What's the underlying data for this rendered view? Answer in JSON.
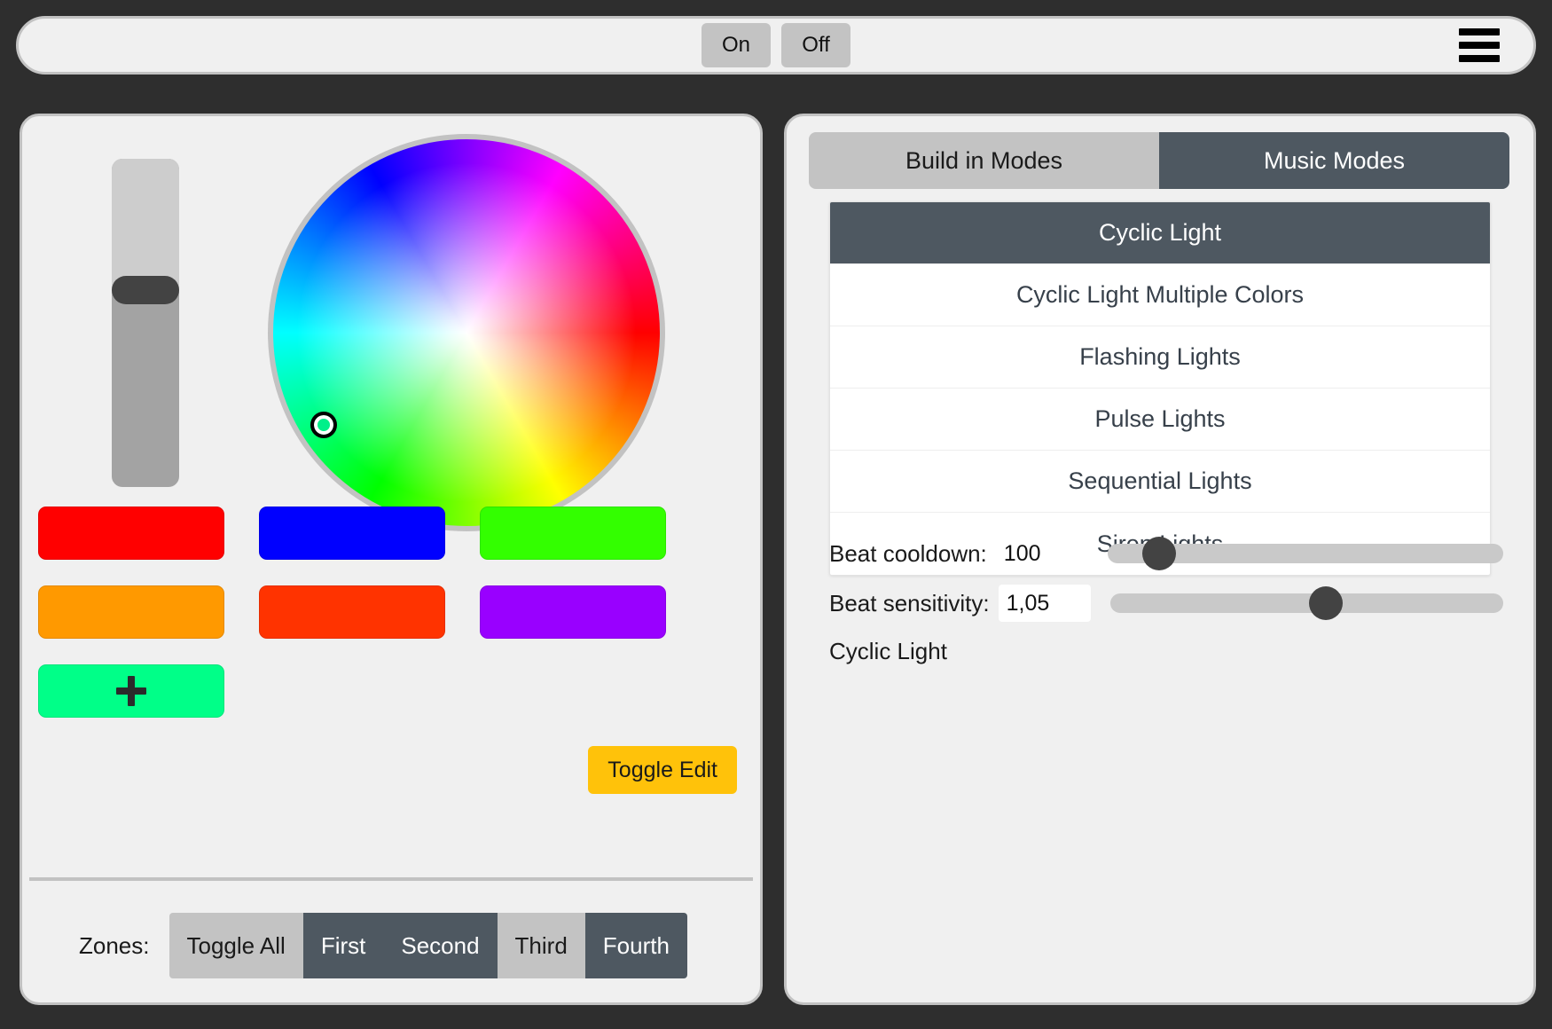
{
  "topbar": {
    "on_label": "On",
    "off_label": "Off",
    "menu_icon": "hamburger-menu-icon"
  },
  "left_panel": {
    "brightness_slider": {
      "name": "brightness-slider",
      "value_percent": 60
    },
    "color_wheel": {
      "name": "color-wheel",
      "selected_color": "#00f08a"
    },
    "swatches": [
      {
        "label": "",
        "color": "#FF0000",
        "name": "color-swatch-red"
      },
      {
        "label": "",
        "color": "#0000FF",
        "name": "color-swatch-blue"
      },
      {
        "label": "",
        "color": "#33FF00",
        "name": "color-swatch-green"
      },
      {
        "label": "",
        "color": "#FF9900",
        "name": "color-swatch-orange"
      },
      {
        "label": "",
        "color": "#FF3300",
        "name": "color-swatch-orangered"
      },
      {
        "label": "",
        "color": "#9900FF",
        "name": "color-swatch-purple"
      },
      {
        "label": "",
        "color": "#00FF88",
        "name": "color-swatch-add"
      }
    ],
    "toggle_edit_label": "Toggle Edit",
    "zones": {
      "label": "Zones:",
      "buttons": [
        {
          "label": "Toggle All",
          "selected": false
        },
        {
          "label": "First",
          "selected": true
        },
        {
          "label": "Second",
          "selected": true
        },
        {
          "label": "Third",
          "selected": false
        },
        {
          "label": "Fourth",
          "selected": true
        }
      ]
    }
  },
  "right_panel": {
    "tabs": [
      {
        "label": "Build in Modes",
        "active": false
      },
      {
        "label": "Music Modes",
        "active": true
      }
    ],
    "modes": [
      {
        "label": "Cyclic Light",
        "selected": true
      },
      {
        "label": "Cyclic Light Multiple Colors",
        "selected": false
      },
      {
        "label": "Flashing Lights",
        "selected": false
      },
      {
        "label": "Pulse Lights",
        "selected": false
      },
      {
        "label": "Sequential Lights",
        "selected": false
      },
      {
        "label": "Siren Lights",
        "selected": false
      }
    ],
    "params": [
      {
        "label": "Beat cooldown:",
        "value": "100",
        "slider_percent": 13
      },
      {
        "label": "Beat sensitivity:",
        "value": "1,05",
        "slider_percent": 55
      }
    ],
    "status_text": "Cyclic Light"
  },
  "colors": {
    "background": "#2e2e2e",
    "panel": "#f0f0f0",
    "panel_border": "#c2c2c2",
    "accent_dark": "#4e5861",
    "button_gray": "#c3c3c3",
    "toggle_edit": "#ffc20a"
  }
}
